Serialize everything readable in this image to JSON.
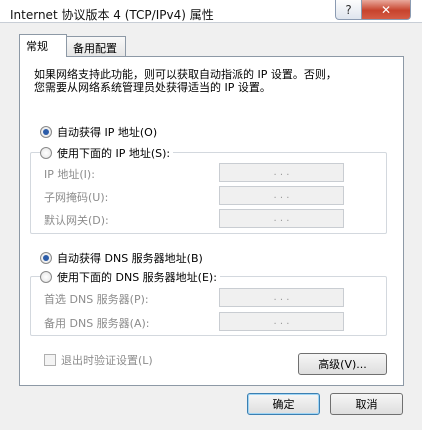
{
  "window": {
    "title": "Internet 协议版本 4 (TCP/IPv4) 属性",
    "help_glyph": "?",
    "close_glyph": "✕"
  },
  "tabs": [
    {
      "label": "常规",
      "active": true
    },
    {
      "label": "备用配置",
      "active": false
    }
  ],
  "description": {
    "line1": "如果网络支持此功能，则可以获取自动指派的 IP 设置。否则，",
    "line2": "您需要从网络系统管理员处获得适当的 IP 设置。"
  },
  "ip": {
    "auto_label": "自动获得 IP 地址(O)",
    "auto_selected": true,
    "manual_label": "使用下面的 IP 地址(S):",
    "manual_selected": false,
    "fields": [
      {
        "label": "IP 地址(I):",
        "value": ". . ."
      },
      {
        "label": "子网掩码(U):",
        "value": ". . ."
      },
      {
        "label": "默认网关(D):",
        "value": ". . ."
      }
    ]
  },
  "dns": {
    "auto_label": "自动获得 DNS 服务器地址(B)",
    "auto_selected": true,
    "manual_label": "使用下面的 DNS 服务器地址(E):",
    "manual_selected": false,
    "fields": [
      {
        "label": "首选 DNS 服务器(P):",
        "value": ". . ."
      },
      {
        "label": "备用 DNS 服务器(A):",
        "value": ". . ."
      }
    ]
  },
  "validate_on_exit": {
    "label": "退出时验证设置(L)",
    "checked": false
  },
  "buttons": {
    "advanced": "高级(V)...",
    "ok": "确定",
    "cancel": "取消"
  },
  "colors": {
    "radio_dot": "#2c5ca8",
    "close_button": "#c7432d",
    "disabled_text": "#8c8c8c"
  }
}
